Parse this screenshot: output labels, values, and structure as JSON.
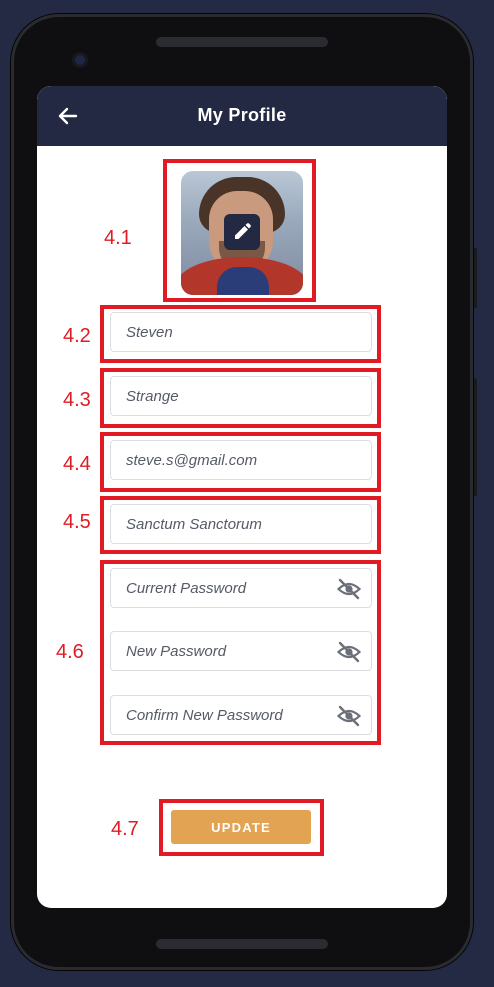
{
  "appbar": {
    "title": "My Profile",
    "back_icon": "arrow-left-icon"
  },
  "profile": {
    "avatar_alt": "profile photo",
    "edit_icon": "pencil-icon"
  },
  "form": {
    "first_name": "Steven",
    "last_name": "Strange",
    "email": "steve.s@gmail.com",
    "address": "Sanctum Sanctorum",
    "current_password_placeholder": "Current Password",
    "new_password_placeholder": "New Password",
    "confirm_password_placeholder": "Confirm New Password",
    "visibility_icon": "eye-off-icon"
  },
  "actions": {
    "update_label": "UPDATE"
  },
  "annotations": {
    "a41": "4.1",
    "a42": "4.2",
    "a43": "4.3",
    "a44": "4.4",
    "a45": "4.5",
    "a46": "4.6",
    "a47": "4.7"
  },
  "colors": {
    "background": "#252a44",
    "appbar": "#232843",
    "accent": "#e2a353",
    "annotation": "#e01b24"
  }
}
